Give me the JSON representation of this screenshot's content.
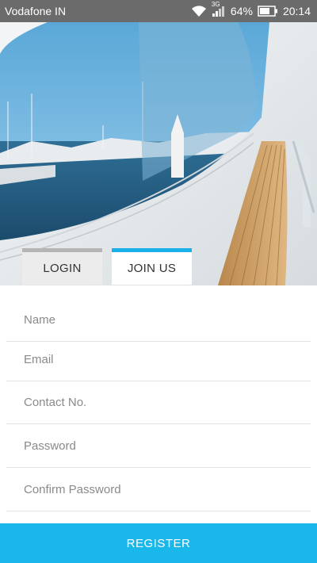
{
  "status": {
    "carrier": "Vodafone IN",
    "network_type": "3G",
    "battery": "64%",
    "time": "20:14",
    "icons": [
      "wifi-icon",
      "signal-icon",
      "battery-icon"
    ]
  },
  "hero": {
    "image": "yacht-deck-photo"
  },
  "tabs": [
    {
      "label": "LOGIN",
      "active": false
    },
    {
      "label": "JOIN US",
      "active": true
    }
  ],
  "form": {
    "fields": [
      {
        "placeholder": "Name",
        "value": ""
      },
      {
        "placeholder": "Email",
        "value": ""
      },
      {
        "placeholder": "Contact No.",
        "value": ""
      },
      {
        "placeholder": "Password",
        "value": ""
      },
      {
        "placeholder": "Confirm Password",
        "value": ""
      }
    ]
  },
  "register": {
    "label": "REGISTER"
  },
  "colors": {
    "accent": "#1ab7ea",
    "status_bar": "#6b6b6b",
    "inactive_tab": "#ececec"
  }
}
